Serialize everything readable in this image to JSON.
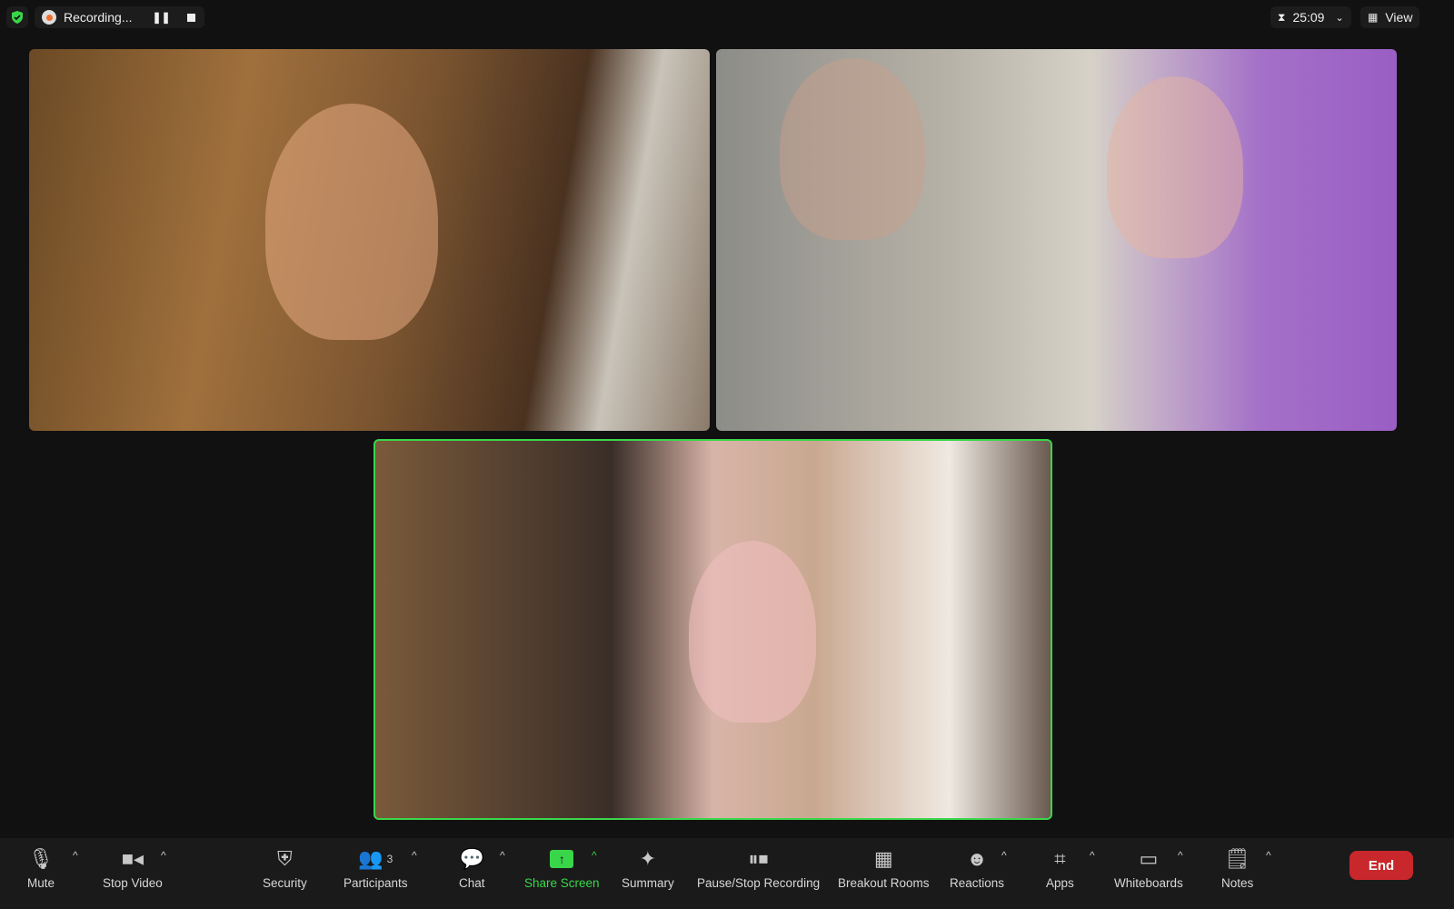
{
  "topbar": {
    "recording_label": "Recording...",
    "timer": "25:09",
    "view_label": "View"
  },
  "colors": {
    "active_speaker_border": "#3ad64a",
    "end_button": "#c8272b",
    "security_shield": "#3ad64a",
    "share_screen": "#3ad64a"
  },
  "toolbar": {
    "mute": "Mute",
    "stop_video": "Stop Video",
    "security": "Security",
    "participants": "Participants",
    "participants_count": "3",
    "chat": "Chat",
    "share_screen": "Share Screen",
    "summary": "Summary",
    "pause_stop_recording": "Pause/Stop Recording",
    "breakout_rooms": "Breakout Rooms",
    "reactions": "Reactions",
    "apps": "Apps",
    "whiteboards": "Whiteboards",
    "notes": "Notes",
    "end": "End"
  }
}
